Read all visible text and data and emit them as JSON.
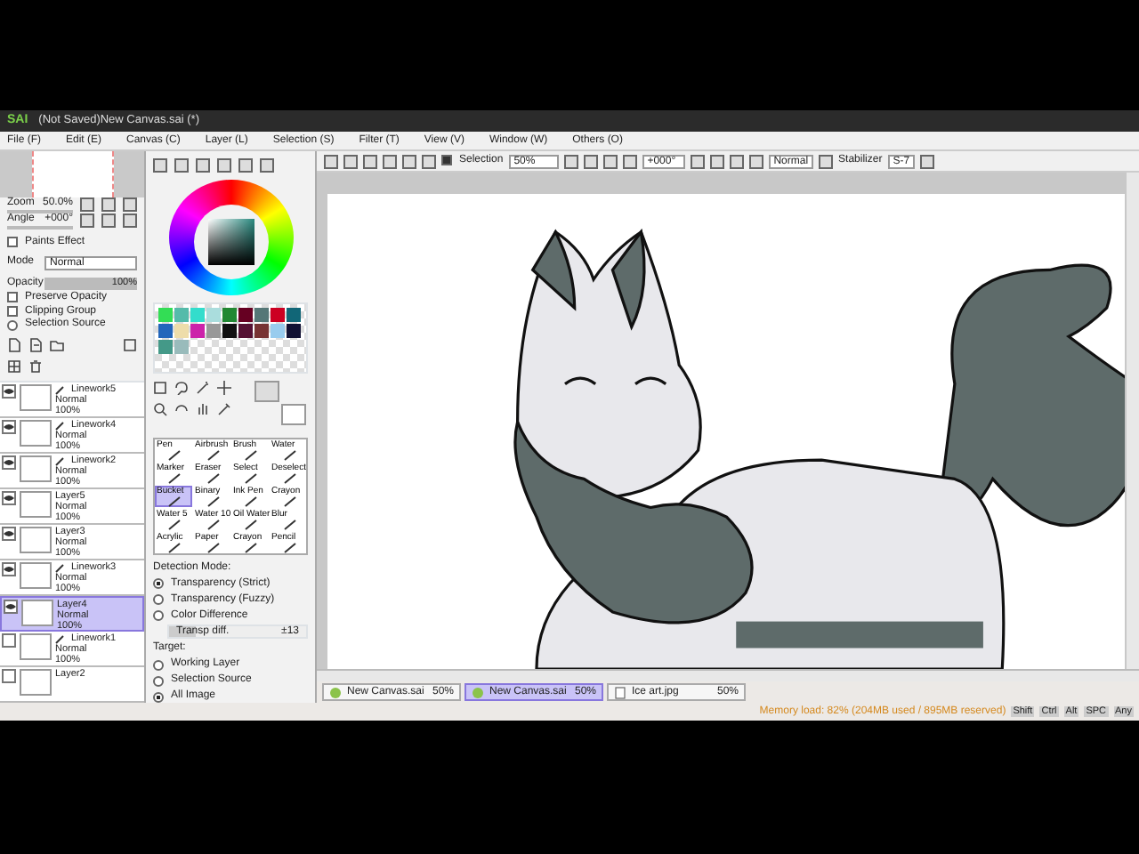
{
  "window": {
    "logo": "SAI",
    "title": "(Not Saved)New Canvas.sai (*)"
  },
  "menu": [
    "File (F)",
    "Edit (E)",
    "Canvas (C)",
    "Layer (L)",
    "Selection (S)",
    "Filter (T)",
    "View (V)",
    "Window (W)",
    "Others (O)"
  ],
  "navigator": {
    "zoom_label": "Zoom",
    "zoom": "50.0%",
    "angle_label": "Angle",
    "angle": "+000°"
  },
  "layer_panel": {
    "effect_label": "Paints Effect",
    "mode_label": "Mode",
    "mode": "Normal",
    "opacity_label": "Opacity",
    "opacity": "100%",
    "level": 1,
    "options": [
      {
        "label": "Preserve Opacity",
        "checked": false
      },
      {
        "label": "Clipping Group",
        "checked": false
      },
      {
        "label": "Selection Source",
        "checked": false
      }
    ]
  },
  "layers": [
    {
      "name": "Linework5",
      "kind": "linework",
      "mode": "Normal",
      "opacity": "100%",
      "visible": true,
      "selected": false
    },
    {
      "name": "Linework4",
      "kind": "linework",
      "mode": "Normal",
      "opacity": "100%",
      "visible": true,
      "selected": false
    },
    {
      "name": "Linework2",
      "kind": "linework",
      "mode": "Normal",
      "opacity": "100%",
      "visible": true,
      "selected": false
    },
    {
      "name": "Layer5",
      "kind": "layer",
      "mode": "Normal",
      "opacity": "100%",
      "visible": true,
      "selected": false
    },
    {
      "name": "Layer3",
      "kind": "layer",
      "mode": "Normal",
      "opacity": "100%",
      "visible": true,
      "selected": false
    },
    {
      "name": "Linework3",
      "kind": "linework",
      "mode": "Normal",
      "opacity": "100%",
      "visible": true,
      "selected": false
    },
    {
      "name": "Layer4",
      "kind": "layer",
      "mode": "Normal",
      "opacity": "100%",
      "visible": true,
      "selected": true
    },
    {
      "name": "Linework1",
      "kind": "linework",
      "mode": "Normal",
      "opacity": "100%",
      "visible": false,
      "selected": false
    },
    {
      "name": "Layer2",
      "kind": "layer",
      "visible": false,
      "selected": false
    }
  ],
  "palette": [
    {
      "color": "#33dd55"
    },
    {
      "color": "#55bbaa"
    },
    {
      "color": "#33ddcc"
    },
    {
      "color": "#aadddd"
    },
    {
      "color": "#228833"
    },
    {
      "color": "#660022"
    },
    {
      "color": "#557777"
    },
    {
      "color": "#cc0022"
    },
    {
      "color": "#116677"
    },
    {
      "color": "#2266bb"
    },
    {
      "color": "#eeddaa"
    },
    {
      "color": "#cc22aa"
    },
    {
      "color": "#999999"
    },
    {
      "color": "#111111"
    },
    {
      "color": "#551133"
    },
    {
      "color": "#773333"
    },
    {
      "color": "#99ccee"
    },
    {
      "color": "#111133"
    },
    {
      "color": "#449988"
    },
    {
      "color": "#99bbbb"
    }
  ],
  "tools": [
    {
      "label": "Pen",
      "selected": false
    },
    {
      "label": "Airbrush",
      "selected": false
    },
    {
      "label": "Brush",
      "selected": false
    },
    {
      "label": "Water",
      "selected": false
    },
    {
      "label": "Marker",
      "selected": false
    },
    {
      "label": "Eraser",
      "selected": false
    },
    {
      "label": "Select",
      "selected": false
    },
    {
      "label": "Deselect",
      "selected": false
    },
    {
      "label": "Bucket",
      "selected": true
    },
    {
      "label": "Binary",
      "selected": false
    },
    {
      "label": "Ink Pen",
      "selected": false
    },
    {
      "label": "Crayon",
      "selected": false
    },
    {
      "label": "Water 5",
      "selected": false
    },
    {
      "label": "Water 10",
      "selected": false
    },
    {
      "label": "Oil Water",
      "selected": false
    },
    {
      "label": "Blur",
      "selected": false
    },
    {
      "label": "Acrylic",
      "selected": false
    },
    {
      "label": "Paper",
      "selected": false
    },
    {
      "label": "Crayon",
      "selected": false
    },
    {
      "label": "Pencil",
      "selected": false
    }
  ],
  "bucket": {
    "detection_label": "Detection Mode:",
    "detection": [
      {
        "label": "Transparency (Strict)",
        "selected": true
      },
      {
        "label": "Transparency (Fuzzy)",
        "selected": false
      },
      {
        "label": "Color Difference",
        "selected": false
      }
    ],
    "diff_label": "Transp diff.",
    "diff": "±13",
    "level": 0.2,
    "target_label": "Target:",
    "target": [
      {
        "label": "Working Layer",
        "selected": false
      },
      {
        "label": "Selection Source",
        "selected": false
      },
      {
        "label": "All Image",
        "selected": true
      }
    ]
  },
  "toolbar": {
    "selection_label": "Selection",
    "selection_checked": true,
    "zoom": "50%",
    "angle": "+000°",
    "blend": "Normal",
    "stabilizer_label": "Stabilizer",
    "stabilizer": "S-7"
  },
  "tabs": [
    {
      "name": "New Canvas.sai",
      "zoom": "50%",
      "kind": "sai",
      "selected": false
    },
    {
      "name": "New Canvas.sai",
      "zoom": "50%",
      "kind": "sai",
      "selected": true
    },
    {
      "name": "Ice art.jpg",
      "zoom": "50%",
      "kind": "jpg",
      "selected": false
    }
  ],
  "status_bar": {
    "memory": "Memory load: 82% (204MB used / 895MB reserved)",
    "keys": [
      "Shift",
      "Ctrl",
      "Alt",
      "SPC",
      "Any"
    ]
  }
}
